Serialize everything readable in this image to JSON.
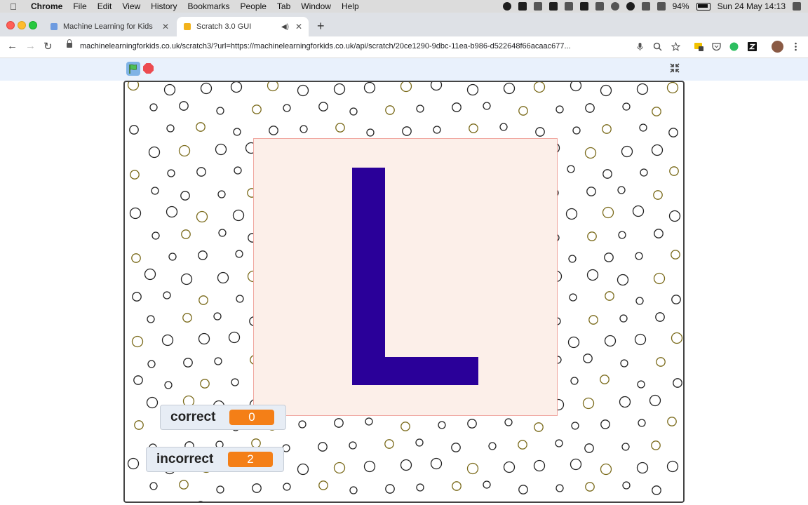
{
  "menubar": {
    "app_name": "Chrome",
    "items": [
      "File",
      "Edit",
      "View",
      "History",
      "Bookmarks",
      "People",
      "Tab",
      "Window",
      "Help"
    ],
    "battery": "94%",
    "datetime": "Sun 24 May  14:13"
  },
  "tabs": [
    {
      "title": "Machine Learning for Kids",
      "favicon_color": "#6d9be0"
    },
    {
      "title": "Scratch 3.0 GUI",
      "favicon_color": "#f2b21b"
    }
  ],
  "address_bar": {
    "url": "machinelearningforkids.co.uk/scratch3/?url=https://machinelearningforkids.co.uk/api/scratch/20ce1290-9dbc-11ea-b986-d522648f66acaac677..."
  },
  "stage": {
    "letter": "L",
    "letter_color": "#2a0099",
    "card_color": "#fcefe9",
    "monitors": [
      {
        "label": "correct",
        "value": "0"
      },
      {
        "label": "incorrect",
        "value": "2"
      }
    ]
  }
}
